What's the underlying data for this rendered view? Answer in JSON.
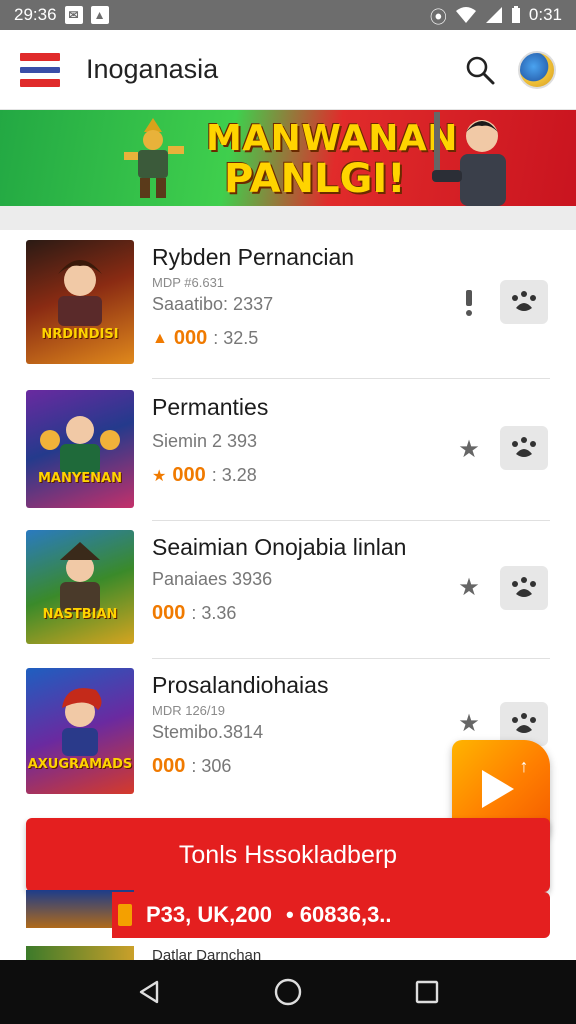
{
  "status_bar": {
    "time": "29:36",
    "clock_right": "0:31",
    "icons": [
      "notification-icon",
      "photo-icon",
      "vibrate-icon",
      "wifi-icon",
      "signal-icon",
      "battery-icon"
    ]
  },
  "app_bar": {
    "title": "Inoganasia",
    "icons": [
      "flag-icon",
      "search-icon",
      "avatar"
    ]
  },
  "banner": {
    "line1": "MANWANAN",
    "line2": "PANLGI!",
    "colors": {
      "left": "#2dbb45",
      "right": "#d81a24",
      "text": "#ffd400"
    }
  },
  "games": [
    {
      "title": "Rybden Pernancian",
      "sub": "MDP #6.631",
      "meta": "Saaatibo: 2337",
      "stars": "000",
      "score": ": 32.5",
      "thumb_text": "NRDINDISI",
      "side_icon": "info-icon",
      "thumb_colors": [
        "#8a2b13",
        "#e0891c"
      ]
    },
    {
      "title": "Permanties",
      "sub": "",
      "meta": "Siemin 2 393",
      "stars": "000",
      "score": ": 3.28",
      "thumb_text": "MANYENAN",
      "side_icon": "star-icon",
      "thumb_colors": [
        "#243a8c",
        "#c4306a"
      ]
    },
    {
      "title": "Seaimian Onojabia linlan",
      "sub": "",
      "meta": "Panaiaes 3936",
      "stars": "000",
      "score": ": 3.36",
      "thumb_text": "NASTBIAN",
      "side_icon": "star-icon",
      "thumb_colors": [
        "#3a8a2a",
        "#d6a420"
      ]
    },
    {
      "title": "Prosalandiohaias",
      "sub": "MDR 126/19",
      "meta": "Stemibo.3814",
      "stars": "000",
      "score": ": 306",
      "thumb_text": "AXUGRAMADS",
      "side_icon": "star-icon",
      "thumb_colors": [
        "#1e5fc0",
        "#d63a2a"
      ]
    }
  ],
  "cta": {
    "label": "Tonls Hssokladberp"
  },
  "price_bar": {
    "left": "P33, UK,200",
    "right": "• 60836,3.."
  },
  "peek": {
    "text": "Datlar Darnchan"
  },
  "nav": [
    "back-icon",
    "home-icon",
    "recents-icon"
  ]
}
